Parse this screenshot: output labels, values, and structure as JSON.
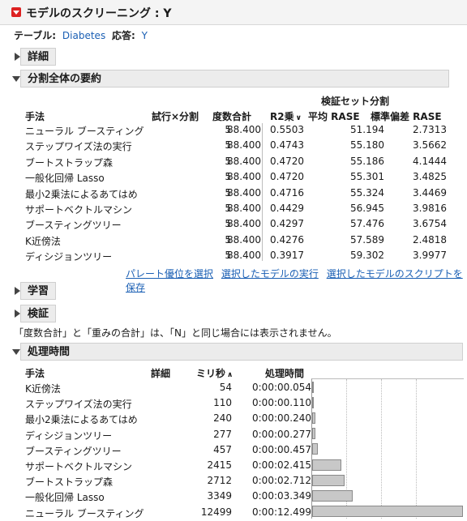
{
  "report": {
    "title": "モデルのスクリーニング : Y",
    "table_label": "テーブル:",
    "table_value": "Diabetes",
    "response_label": "応答:",
    "response_value": "Y"
  },
  "sections": {
    "details": "詳細",
    "summary": "分割全体の要約",
    "training": "学習",
    "validation": "検証",
    "timing": "処理時間"
  },
  "summary": {
    "group_header": "検証セット分割",
    "columns": [
      "手法",
      "試行×分割",
      "度数合計",
      "R2乗",
      "平均 RASE",
      "標準偏差 RASE"
    ],
    "rows": [
      {
        "method": "ニューラル ブースティング",
        "trials": "5",
        "count": "88.400",
        "r2": "0.5503",
        "mean_rase": "51.194",
        "sd_rase": "2.7313"
      },
      {
        "method": "ステップワイズ法の実行",
        "trials": "5",
        "count": "88.400",
        "r2": "0.4743",
        "mean_rase": "55.180",
        "sd_rase": "3.5662"
      },
      {
        "method": "ブートストラップ森",
        "trials": "5",
        "count": "88.400",
        "r2": "0.4720",
        "mean_rase": "55.186",
        "sd_rase": "4.1444"
      },
      {
        "method": "一般化回帰 Lasso",
        "trials": "5",
        "count": "88.400",
        "r2": "0.4720",
        "mean_rase": "55.301",
        "sd_rase": "3.4825"
      },
      {
        "method": "最小2乗法によるあてはめ",
        "trials": "5",
        "count": "88.400",
        "r2": "0.4716",
        "mean_rase": "55.324",
        "sd_rase": "3.4469"
      },
      {
        "method": "サポートベクトルマシン",
        "trials": "5",
        "count": "88.400",
        "r2": "0.4429",
        "mean_rase": "56.945",
        "sd_rase": "3.9816"
      },
      {
        "method": "ブースティングツリー",
        "trials": "5",
        "count": "88.400",
        "r2": "0.4297",
        "mean_rase": "57.476",
        "sd_rase": "3.6754"
      },
      {
        "method": "K近傍法",
        "trials": "5",
        "count": "88.400",
        "r2": "0.4276",
        "mean_rase": "57.589",
        "sd_rase": "2.4818"
      },
      {
        "method": "ディシジョンツリー",
        "trials": "5",
        "count": "88.400",
        "r2": "0.3917",
        "mean_rase": "59.302",
        "sd_rase": "3.9977"
      }
    ],
    "links": [
      "パレート優位を選択",
      "選択したモデルの実行",
      "選択したモデルのスクリプトを保存"
    ]
  },
  "note": "「度数合計」と「重みの合計」は、「N」と同じ場合には表示されません。",
  "timing": {
    "columns": [
      "手法",
      "詳細",
      "ミリ秒",
      "処理時間"
    ],
    "max_ms": 12499,
    "rows": [
      {
        "method": "K近傍法",
        "ms": "54",
        "time": "0:00:00.054",
        "value": 54
      },
      {
        "method": "ステップワイズ法の実行",
        "ms": "110",
        "time": "0:00:00.110",
        "value": 110
      },
      {
        "method": "最小2乗法によるあてはめ",
        "ms": "240",
        "time": "0:00:00.240",
        "value": 240
      },
      {
        "method": "ディシジョンツリー",
        "ms": "277",
        "time": "0:00:00.277",
        "value": 277
      },
      {
        "method": "ブースティングツリー",
        "ms": "457",
        "time": "0:00:00.457",
        "value": 457
      },
      {
        "method": "サポートベクトルマシン",
        "ms": "2415",
        "time": "0:00:02.415",
        "value": 2415
      },
      {
        "method": "ブートストラップ森",
        "ms": "2712",
        "time": "0:00:02.712",
        "value": 2712
      },
      {
        "method": "一般化回帰 Lasso",
        "ms": "3349",
        "time": "0:00:03.349",
        "value": 3349
      },
      {
        "method": "ニューラル ブースティング",
        "ms": "12499",
        "time": "0:00:12.499",
        "value": 12499
      }
    ]
  },
  "colors": {
    "link": "#1a5fb4",
    "bar_fill": "#c8c8c8",
    "bar_border": "#8a8a8a",
    "menu_button": "#d22222"
  }
}
